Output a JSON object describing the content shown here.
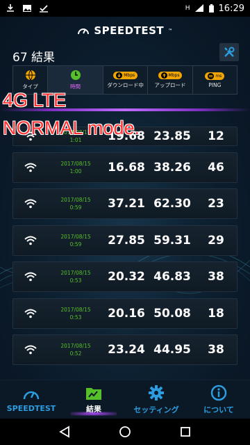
{
  "status_bar": {
    "time": "16:29",
    "network": "H"
  },
  "header": {
    "brand": "SPEEDTEST"
  },
  "results": {
    "title": "67 結果"
  },
  "columns": [
    {
      "label": "タイプ",
      "icon": "globe-icon"
    },
    {
      "label": "時間",
      "icon": "clock-icon"
    },
    {
      "label": "ダウンロード中",
      "unit": "Mbps",
      "icon": "download-icon"
    },
    {
      "label": "アップロード",
      "unit": "Mbps",
      "icon": "upload-icon"
    },
    {
      "label": "PING",
      "unit": "ms",
      "icon": "ping-icon"
    }
  ],
  "annotation": {
    "line1": "4G LTE",
    "line2": "NORMAL mode."
  },
  "rows": [
    {
      "date": "2017/08/15",
      "time": "1:01",
      "download": "19.68",
      "upload": "23.85",
      "ping": "12"
    },
    {
      "date": "2017/08/15",
      "time": "1:00",
      "download": "16.68",
      "upload": "38.26",
      "ping": "46"
    },
    {
      "date": "2017/08/15",
      "time": "0:59",
      "download": "37.21",
      "upload": "62.30",
      "ping": "23"
    },
    {
      "date": "2017/08/15",
      "time": "0:59",
      "download": "27.85",
      "upload": "59.31",
      "ping": "29"
    },
    {
      "date": "2017/08/15",
      "time": "0:53",
      "download": "20.32",
      "upload": "46.83",
      "ping": "38"
    },
    {
      "date": "2017/08/15",
      "time": "0:53",
      "download": "20.16",
      "upload": "50.08",
      "ping": "18"
    },
    {
      "date": "2017/08/15",
      "time": "0:52",
      "download": "23.24",
      "upload": "44.95",
      "ping": "38"
    }
  ],
  "nav": [
    {
      "label": "SPEEDTEST",
      "icon": "speedometer-icon"
    },
    {
      "label": "結果",
      "icon": "results-folder-icon",
      "active": true
    },
    {
      "label": "セッティング",
      "icon": "gear-icon"
    },
    {
      "label": "について",
      "icon": "info-icon"
    }
  ],
  "colors": {
    "accent": "#2b9de0",
    "time_green": "#56c02a",
    "pill_orange": "#f0a500",
    "annot_red": "#ff3030"
  }
}
